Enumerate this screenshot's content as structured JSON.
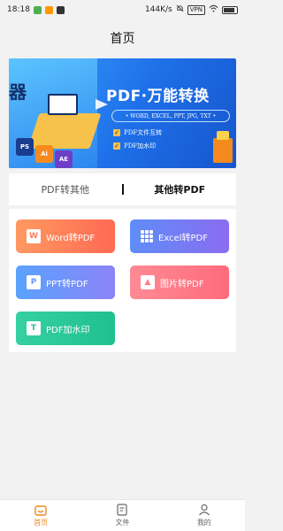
{
  "status_bar": {
    "time": "18:18",
    "network_speed": "144K/s",
    "network_badge": "VPN",
    "icons": [
      "green-app-icon",
      "orange-app-icon",
      "dark-app-icon",
      "mute-icon",
      "wifi-icon",
      "battery-icon"
    ]
  },
  "header": {
    "title": "首页"
  },
  "banner": {
    "left_char": "器",
    "title": "PDF·万能转换",
    "formats": "• WORD, EXCEL, PPT, JPG, TXT •",
    "features": [
      "PDF文件互转",
      "PDF加水印"
    ],
    "tiles": [
      "PS",
      "Ai",
      "AE"
    ]
  },
  "tabs": [
    {
      "label": "PDF转其他",
      "active": false
    },
    {
      "label": "其他转PDF",
      "active": true
    }
  ],
  "converters": [
    {
      "label": "Word转PDF",
      "icon": "word-doc-icon",
      "icon_char": "W"
    },
    {
      "label": "Excel转PDF",
      "icon": "excel-grid-icon",
      "icon_char": ""
    },
    {
      "label": "PPT转PDF",
      "icon": "ppt-icon",
      "icon_char": "P"
    },
    {
      "label": "图片转PDF",
      "icon": "image-icon",
      "icon_char": "▲"
    },
    {
      "label": "PDF加水印",
      "icon": "watermark-icon",
      "icon_char": "T"
    }
  ],
  "bottom_nav": [
    {
      "label": "首页",
      "icon": "home-icon",
      "active": true
    },
    {
      "label": "文件",
      "icon": "file-icon",
      "active": false
    },
    {
      "label": "我的",
      "icon": "profile-icon",
      "active": false
    }
  ],
  "colors": {
    "accent": "#f08a1c",
    "word": "#ff7b59",
    "excel": "#6f82f5",
    "ppt": "#6a93ff",
    "image": "#ff7a86",
    "watermark": "#23c493"
  }
}
